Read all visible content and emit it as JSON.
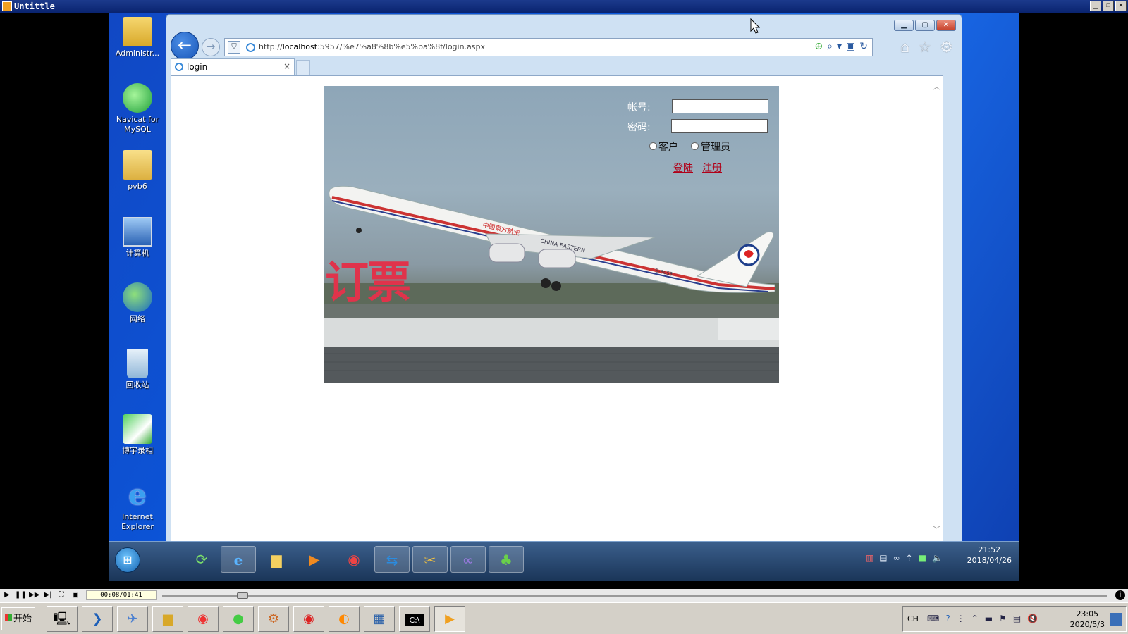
{
  "player": {
    "title": "Untittle",
    "window_buttons": [
      "_",
      "❐",
      "✕"
    ],
    "time_display": "00:08/01:41",
    "progress": 0.08
  },
  "desktop": {
    "icons": [
      {
        "name": "admin",
        "label": "Administr...",
        "icon": "user-folder-icon"
      },
      {
        "name": "navicat",
        "label": "Navicat for MySQL",
        "icon": "navicat-icon"
      },
      {
        "name": "pvb6",
        "label": "pvb6",
        "icon": "folder-icon"
      },
      {
        "name": "computer",
        "label": "计算机",
        "icon": "computer-icon"
      },
      {
        "name": "network",
        "label": "网络",
        "icon": "network-icon"
      },
      {
        "name": "recycle",
        "label": "回收站",
        "icon": "recycle-bin-icon"
      },
      {
        "name": "boyu",
        "label": "博宇录相",
        "icon": "recorder-icon"
      },
      {
        "name": "ie",
        "label": "Internet Explorer",
        "icon": "ie-icon"
      }
    ]
  },
  "browser": {
    "url_prefix": "http://",
    "url_host": "localhost",
    "url_rest": ":5957/%e7%a8%8b%e5%ba%8f/login.aspx",
    "tab_label": "login",
    "tab_close": "×"
  },
  "login": {
    "account_label": "帐号:",
    "password_label": "密码:",
    "account_value": "",
    "password_value": "",
    "role_customer": "客户",
    "role_admin": "管理员",
    "login_link": "登陆",
    "register_link": "注册",
    "banner_text": "订票",
    "plane_livery": "中國東方航空",
    "plane_livery_en": "CHINA EASTERN",
    "plane_reg": "B-6053"
  },
  "recorded_taskbar": {
    "time": "21:52",
    "date": "2018/04/26"
  },
  "host_taskbar": {
    "start_label": "开始",
    "lang": "CH",
    "time": "23:05",
    "date": "2020/5/3"
  },
  "colors": {
    "link": "#b00018",
    "banner": "#e0334b",
    "desktop": "#0a58dd"
  }
}
